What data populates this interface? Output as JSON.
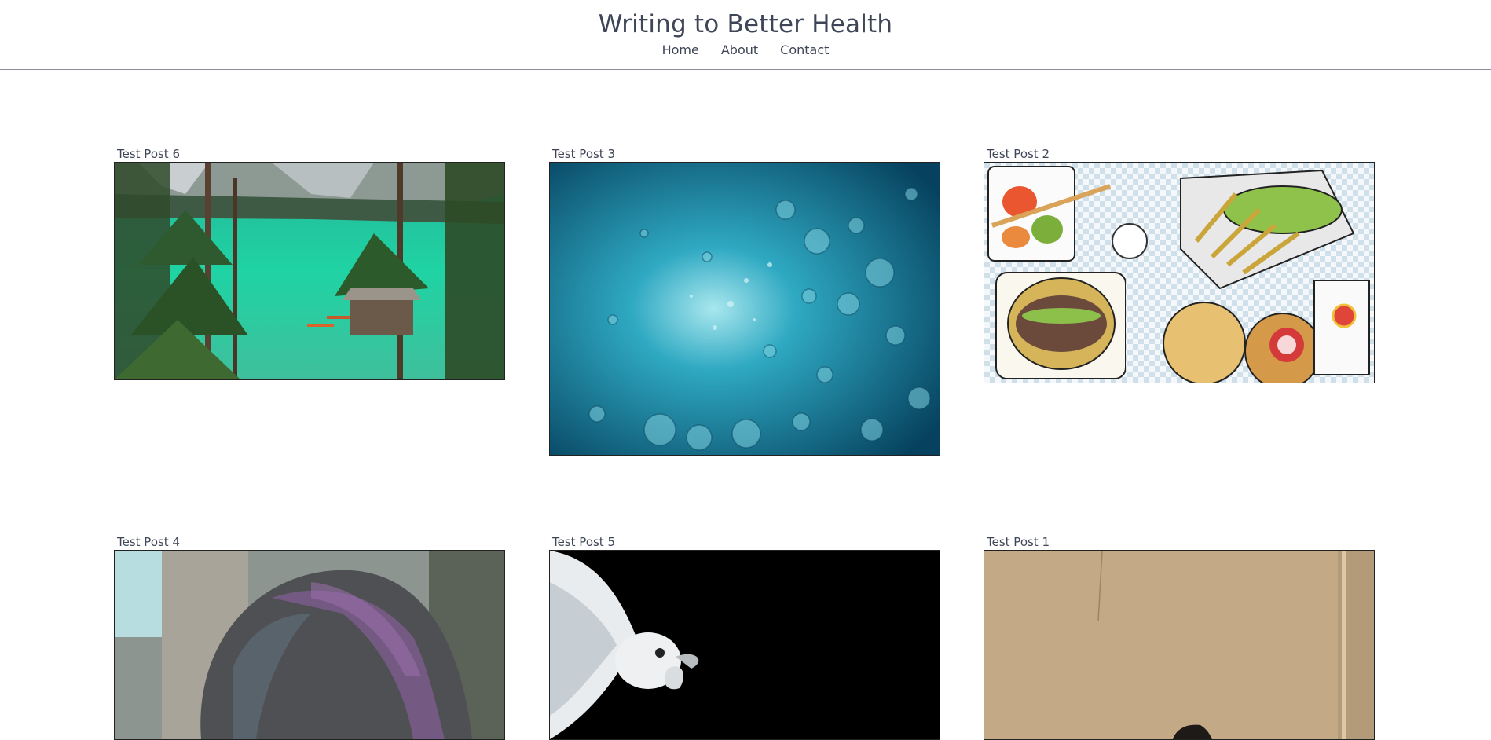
{
  "site": {
    "title": "Writing to Better Health"
  },
  "nav": {
    "items": [
      {
        "label": "Home"
      },
      {
        "label": "About"
      },
      {
        "label": "Contact"
      }
    ]
  },
  "posts": [
    {
      "title": "Test Post 6",
      "image": "alpine-lake-boathouse-image"
    },
    {
      "title": "Test Post 3",
      "image": "underwater-bubbles-image"
    },
    {
      "title": "Test Post 2",
      "image": "fast-food-illustration-image"
    },
    {
      "title": "Test Post 4",
      "image": "purple-hair-image"
    },
    {
      "title": "Test Post 5",
      "image": "betta-fish-image"
    },
    {
      "title": "Test Post 1",
      "image": "beige-wall-image"
    }
  ]
}
